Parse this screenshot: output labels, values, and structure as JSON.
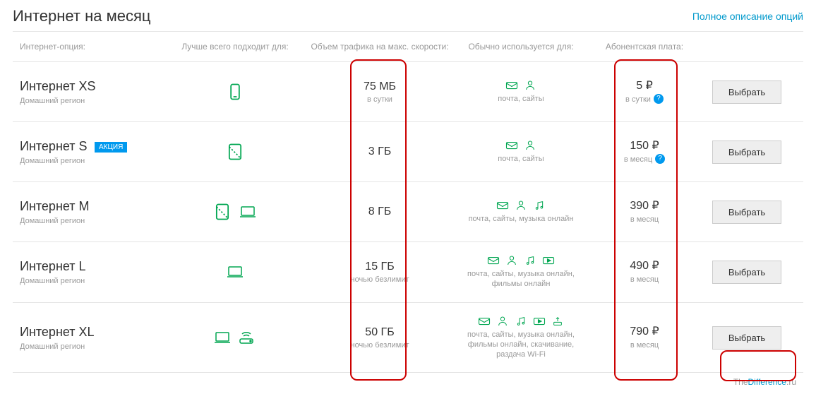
{
  "header": {
    "title": "Интернет на месяц",
    "full_desc": "Полное описание опций"
  },
  "columns": {
    "c1": "Интернет-опция:",
    "c2": "Лучше всего подходит для:",
    "c3": "Объем трафика на макс. скорости:",
    "c4": "Обычно используется для:",
    "c5": "Абонентская плата:"
  },
  "promo": "АКЦИЯ",
  "rows": [
    {
      "name": "Интернет XS",
      "region": "Домашний регион",
      "promo": false,
      "traffic": "75 МБ",
      "traffic_period": "в сутки",
      "usage": "почта, сайты",
      "price": "5 ₽",
      "price_period": "в сутки",
      "info": true,
      "btn": "Выбрать"
    },
    {
      "name": "Интернет S",
      "region": "Домашний регион",
      "promo": true,
      "traffic": "3 ГБ",
      "traffic_period": "",
      "usage": "почта, сайты",
      "price": "150 ₽",
      "price_period": "в месяц",
      "info": true,
      "btn": "Выбрать"
    },
    {
      "name": "Интернет M",
      "region": "Домашний регион",
      "promo": false,
      "traffic": "8 ГБ",
      "traffic_period": "",
      "usage": "почта, сайты, музыка онлайн",
      "price": "390 ₽",
      "price_period": "в месяц",
      "info": false,
      "btn": "Выбрать"
    },
    {
      "name": "Интернет L",
      "region": "Домашний регион",
      "promo": false,
      "traffic": "15 ГБ",
      "traffic_period": "ночью безлимит",
      "usage": "почта, сайты, музыка онлайн, фильмы онлайн",
      "price": "490 ₽",
      "price_period": "в месяц",
      "info": false,
      "btn": "Выбрать"
    },
    {
      "name": "Интернет XL",
      "region": "Домашний регион",
      "promo": false,
      "traffic": "50 ГБ",
      "traffic_period": "ночью безлимит",
      "usage": "почта, сайты, музыка онлайн, фильмы онлайн, скачивание, раздача Wi-Fi",
      "price": "790 ₽",
      "price_period": "в месяц",
      "info": false,
      "btn": "Выбрать"
    }
  ],
  "footer": {
    "brand1": "The",
    "brand2": "Difference",
    "tld": ".ru"
  }
}
